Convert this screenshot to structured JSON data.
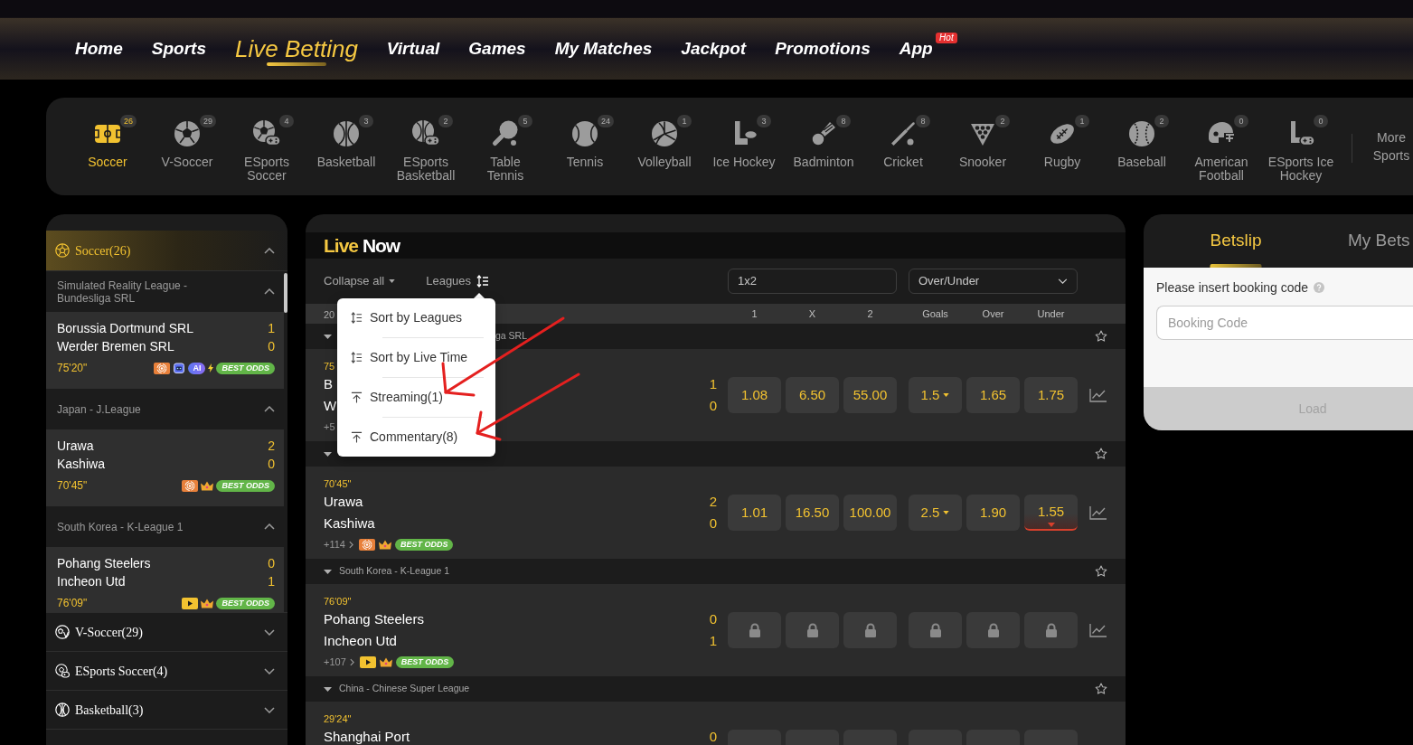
{
  "nav": [
    {
      "label": "Home",
      "selected": false
    },
    {
      "label": "Sports",
      "selected": false
    },
    {
      "label": "Live Betting",
      "selected": true
    },
    {
      "label": "Virtual",
      "selected": false
    },
    {
      "label": "Games",
      "selected": false
    },
    {
      "label": "My Matches",
      "selected": false
    },
    {
      "label": "Jackpot",
      "selected": false
    },
    {
      "label": "Promotions",
      "selected": false
    },
    {
      "label": "App",
      "selected": false,
      "badge": "Hot"
    }
  ],
  "sports_bar": {
    "items": [
      {
        "kind": "soccer",
        "label": "Soccer",
        "count": "26",
        "selected": true
      },
      {
        "kind": "vsoccer",
        "label": "V-Soccer",
        "count": "29",
        "selected": false
      },
      {
        "kind": "esports_soccer",
        "label": "ESports Soccer",
        "count": "4",
        "selected": false
      },
      {
        "kind": "basketball",
        "label": "Basketball",
        "count": "3",
        "selected": false
      },
      {
        "kind": "esports_basketball",
        "label": "ESports Basketball",
        "count": "2",
        "selected": false
      },
      {
        "kind": "table_tennis",
        "label": "Table Tennis",
        "count": "5",
        "selected": false
      },
      {
        "kind": "tennis",
        "label": "Tennis",
        "count": "24",
        "selected": false
      },
      {
        "kind": "volleyball",
        "label": "Volleyball",
        "count": "1",
        "selected": false
      },
      {
        "kind": "ice_hockey",
        "label": "Ice Hockey",
        "count": "3",
        "selected": false
      },
      {
        "kind": "badminton",
        "label": "Badminton",
        "count": "8",
        "selected": false
      },
      {
        "kind": "cricket",
        "label": "Cricket",
        "count": "8",
        "selected": false
      },
      {
        "kind": "snooker",
        "label": "Snooker",
        "count": "2",
        "selected": false
      },
      {
        "kind": "rugby",
        "label": "Rugby",
        "count": "1",
        "selected": false
      },
      {
        "kind": "baseball",
        "label": "Baseball",
        "count": "2",
        "selected": false
      },
      {
        "kind": "american_football",
        "label": "American Football",
        "count": "0",
        "selected": false
      },
      {
        "kind": "esports_ice_hockey",
        "label": "ESports Ice Hockey",
        "count": "0",
        "selected": false
      }
    ],
    "more": "More Sports"
  },
  "sidebar": {
    "sports": [
      {
        "kind": "soccer",
        "label": "Soccer(26)",
        "selected": true,
        "expanded": true,
        "leagues": [
          {
            "name": "Simulated Reality League - Bundesliga SRL",
            "expanded": true,
            "matches": [
              {
                "home": "Borussia Dortmund SRL",
                "home_score": "1",
                "away": "Werder Bremen SRL",
                "away_score": "0",
                "time": "75'20\"",
                "badges": [
                  {
                    "kind": "stream"
                  },
                  {
                    "kind": "ai",
                    "label": "AI"
                  },
                  {
                    "kind": "best_odds",
                    "label": "BEST ODDS",
                    "crown": false
                  }
                ]
              }
            ]
          },
          {
            "name": "Japan - J.League",
            "expanded": true,
            "matches": [
              {
                "home": "Urawa",
                "home_score": "2",
                "away": "Kashiwa",
                "away_score": "0",
                "time": "70'45\"",
                "badges": [
                  {
                    "kind": "stream"
                  },
                  {
                    "kind": "best_odds",
                    "label": "BEST ODDS",
                    "crown": true
                  }
                ]
              }
            ]
          },
          {
            "name": "South Korea - K-League 1",
            "expanded": true,
            "matches": [
              {
                "home": "Pohang Steelers",
                "home_score": "0",
                "away": "Incheon Utd",
                "away_score": "1",
                "time": "76'09\"",
                "badges": [
                  {
                    "kind": "play"
                  },
                  {
                    "kind": "best_odds",
                    "label": "BEST ODDS",
                    "crown": true
                  }
                ]
              }
            ]
          }
        ]
      },
      {
        "kind": "vsoccer",
        "label": "V-Soccer(29)",
        "selected": false,
        "expanded": false
      },
      {
        "kind": "esports_soccer",
        "label": "ESports Soccer(4)",
        "selected": false,
        "expanded": false
      },
      {
        "kind": "basketball",
        "label": "Basketball(3)",
        "selected": false,
        "expanded": false
      }
    ]
  },
  "live": {
    "title": {
      "accent": "Live",
      "rest": "Now"
    },
    "collapse": "Collapse all",
    "sort": "Leagues",
    "sort_menu": {
      "open": true,
      "items": [
        {
          "kind": "sort",
          "label": "Sort by Leagues"
        },
        {
          "kind": "sort",
          "label": "Sort by Live Time"
        },
        {
          "kind": "pin",
          "label": "Streaming(1)"
        },
        {
          "kind": "pin",
          "label": "Commentary(8)"
        }
      ]
    },
    "markets": [
      {
        "kind": "box",
        "value": "1x2"
      },
      {
        "kind": "select",
        "value": "Over/Under"
      }
    ],
    "header": {
      "date": "20",
      "columns": [
        [
          "1",
          "X",
          "2"
        ],
        [
          "Goals",
          "Over",
          "Under"
        ]
      ]
    },
    "leagues": [
      {
        "name": "ga SRL",
        "partial": true,
        "expanded": true,
        "matches": [
          {
            "time": "75",
            "home": "B",
            "home_score": "1",
            "away": "W",
            "away_score": "0",
            "more": "+5",
            "arrow": false,
            "odds": [
              [
                {
                  "kind": "price",
                  "value": "1.08"
                },
                {
                  "kind": "price",
                  "value": "6.50"
                },
                {
                  "kind": "price",
                  "value": "55.00"
                }
              ],
              [
                {
                  "kind": "line",
                  "value": "1.5"
                },
                {
                  "kind": "price",
                  "value": "1.65"
                },
                {
                  "kind": "price",
                  "value": "1.75"
                }
              ]
            ],
            "chart": true
          }
        ]
      },
      {
        "expanded": true,
        "matches": [
          {
            "time": "70'45\"",
            "home": "Urawa",
            "home_score": "2",
            "away": "Kashiwa",
            "away_score": "0",
            "more": "+114",
            "arrow": true,
            "badges": [
              {
                "kind": "stream"
              },
              {
                "kind": "best_odds",
                "label": "BEST ODDS",
                "crown": true
              }
            ],
            "odds": [
              [
                {
                  "kind": "price",
                  "value": "1.01"
                },
                {
                  "kind": "price",
                  "value": "16.50"
                },
                {
                  "kind": "price",
                  "value": "100.00"
                }
              ],
              [
                {
                  "kind": "line",
                  "value": "2.5"
                },
                {
                  "kind": "price",
                  "value": "1.90"
                },
                {
                  "kind": "price",
                  "value": "1.55",
                  "dropping": true
                }
              ]
            ],
            "chart": true
          }
        ]
      },
      {
        "name": "South Korea - K-League 1",
        "expanded": true,
        "matches": [
          {
            "time": "76'09\"",
            "home": "Pohang Steelers",
            "home_score": "0",
            "away": "Incheon Utd",
            "away_score": "1",
            "more": "+107",
            "arrow": true,
            "badges": [
              {
                "kind": "play"
              },
              {
                "kind": "best_odds",
                "label": "BEST ODDS",
                "crown": true
              }
            ],
            "odds": [
              [
                {
                  "kind": "locked"
                },
                {
                  "kind": "locked"
                },
                {
                  "kind": "locked"
                }
              ],
              [
                {
                  "kind": "locked"
                },
                {
                  "kind": "locked"
                },
                {
                  "kind": "locked"
                }
              ]
            ],
            "chart": true
          }
        ]
      },
      {
        "name": "China - Chinese Super League",
        "expanded": true,
        "matches": [
          {
            "time": "29'24\"",
            "home": "Shanghai Port",
            "home_score": "0",
            "odds": [
              [
                {
                  "kind": "blank"
                },
                {
                  "kind": "blank"
                },
                {
                  "kind": "blank"
                }
              ],
              [
                {
                  "kind": "blank"
                },
                {
                  "kind": "blank"
                },
                {
                  "kind": "blank"
                }
              ]
            ],
            "chart": false
          }
        ]
      }
    ]
  },
  "betslip": {
    "tabs": [
      {
        "label": "Betslip",
        "selected": true
      },
      {
        "label": "My Bets",
        "selected": false
      }
    ],
    "prompt": "Please insert booking code",
    "placeholder": "Booking Code",
    "load": {
      "label": "Load",
      "disabled": true
    }
  },
  "annotations": [
    {
      "kind": "arrow"
    },
    {
      "kind": "arrow"
    }
  ]
}
